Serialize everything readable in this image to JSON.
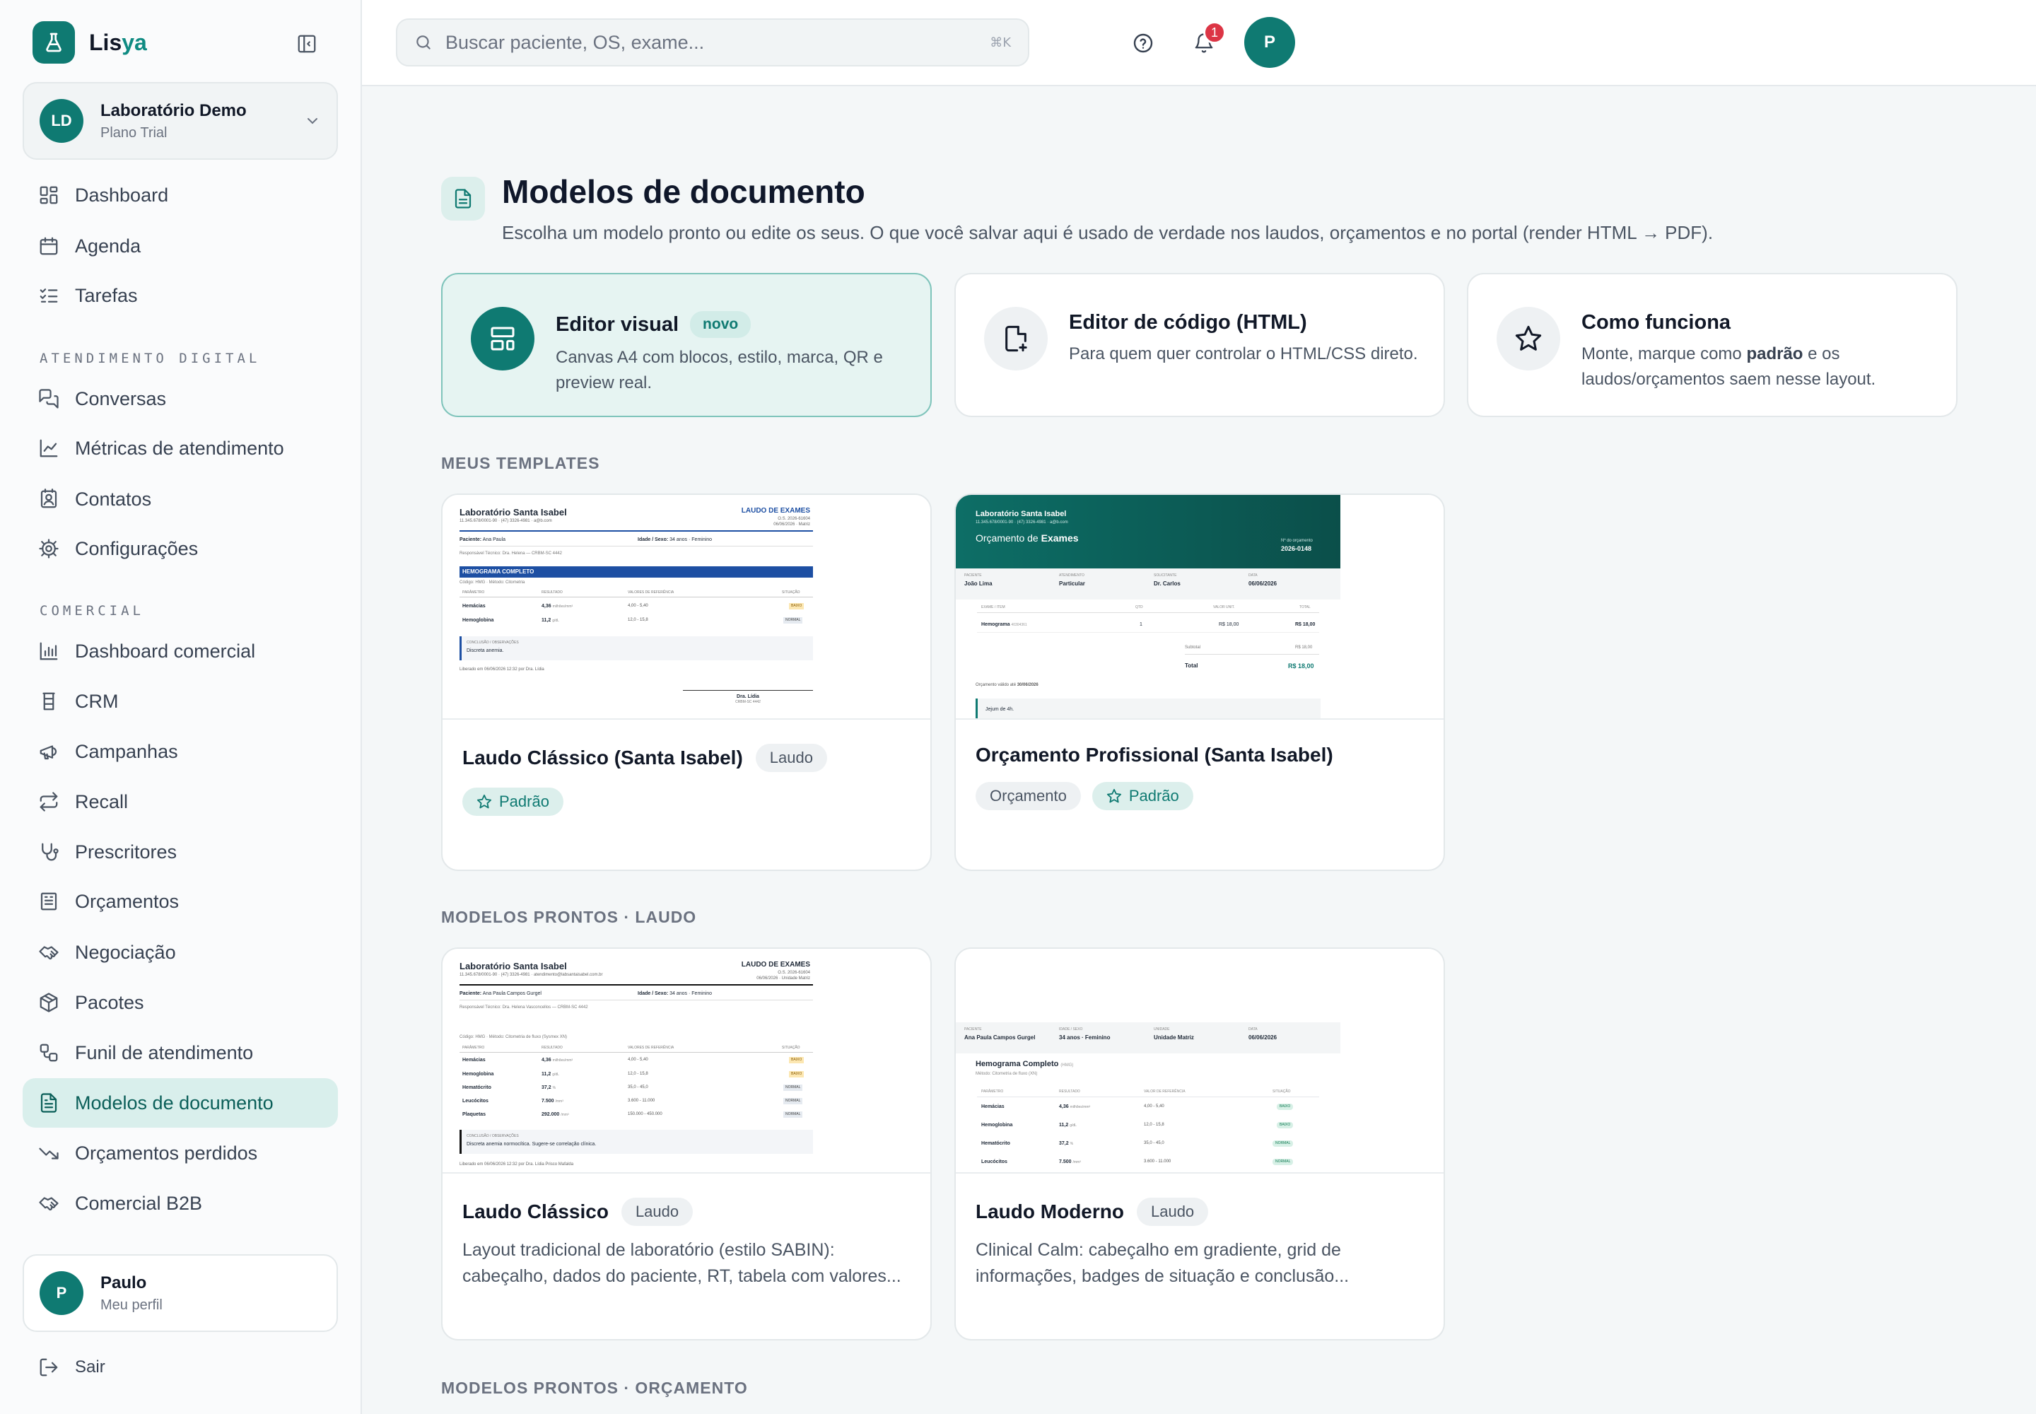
{
  "brand": {
    "name_prefix": "Lis",
    "name_accent": "ya"
  },
  "org": {
    "initials": "LD",
    "name": "Laboratório Demo",
    "plan": "Plano Trial"
  },
  "nav": {
    "main": [
      {
        "label": "Dashboard"
      },
      {
        "label": "Agenda"
      },
      {
        "label": "Tarefas"
      }
    ],
    "section_atendimento": "ATENDIMENTO DIGITAL",
    "atendimento": [
      {
        "label": "Conversas"
      },
      {
        "label": "Métricas de atendimento"
      },
      {
        "label": "Contatos"
      },
      {
        "label": "Configurações"
      }
    ],
    "section_comercial": "COMERCIAL",
    "comercial": [
      {
        "label": "Dashboard comercial"
      },
      {
        "label": "CRM"
      },
      {
        "label": "Campanhas"
      },
      {
        "label": "Recall"
      },
      {
        "label": "Prescritores"
      },
      {
        "label": "Orçamentos"
      },
      {
        "label": "Negociação"
      },
      {
        "label": "Pacotes"
      },
      {
        "label": "Funil de atendimento"
      },
      {
        "label": "Modelos de documento"
      },
      {
        "label": "Orçamentos perdidos"
      },
      {
        "label": "Comercial B2B"
      }
    ]
  },
  "user": {
    "initial": "P",
    "name": "Paulo",
    "subtitle": "Meu perfil"
  },
  "logout": "Sair",
  "search": {
    "placeholder": "Buscar paciente, OS, exame...",
    "shortcut": "⌘K"
  },
  "notifications": {
    "count": "1"
  },
  "page": {
    "title": "Modelos de documento",
    "subtitle": "Escolha um modelo pronto ou edite os seus. O que você salvar aqui é usado de verdade nos laudos, orçamentos e no portal (render HTML → PDF)."
  },
  "features": [
    {
      "title": "Editor visual",
      "badge": "novo",
      "desc": "Canvas A4 com blocos, estilo, marca, QR e preview real."
    },
    {
      "title": "Editor de código (HTML)",
      "desc": "Para quem quer controlar o HTML/CSS direto."
    },
    {
      "title": "Como funciona",
      "desc_pre": "Monte, marque como ",
      "desc_bold": "padrão",
      "desc_post": " e os laudos/orçamentos saem nesse layout."
    }
  ],
  "sections": {
    "mine": "MEUS TEMPLATES",
    "laudo": "MODELOS PRONTOS · LAUDO",
    "orcamento": "MODELOS PRONTOS · ORÇAMENTO"
  },
  "my_templates": [
    {
      "title": "Laudo Clássico (Santa Isabel)",
      "type": "Laudo",
      "default": "Padrão"
    },
    {
      "title": "Orçamento Profissional (Santa Isabel)",
      "type": "Orçamento",
      "default": "Padrão"
    }
  ],
  "laudo_templates": [
    {
      "title": "Laudo Clássico",
      "type": "Laudo",
      "desc": "Layout tradicional de laboratório (estilo SABIN): cabeçalho, dados do paciente, RT, tabela com valores..."
    },
    {
      "title": "Laudo Moderno",
      "type": "Laudo",
      "desc": "Clinical Calm: cabeçalho em gradiente, grid de informações, badges de situação e conclusão..."
    }
  ],
  "previews": {
    "lab": "Laboratório Santa Isabel",
    "lab_info": "11.345.678/0001-90 · (47) 3326-4981 · a@b.com",
    "doc": "LAUDO DE EXAMES",
    "os": "O.S. 2026-61604",
    "date": "06/06/2026 · Matriz",
    "patient_label": "Paciente:",
    "patient": "Ana Paula",
    "age_label": "Idade / Sexo:",
    "age": "34 anos · Feminino",
    "rt": "Responsável Técnico: Dra. Helena — CRBM-SC 4442",
    "exam": "HEMOGRAMA COMPLETO",
    "exam_sub": "Código: HMG · Método: Citometria",
    "cols": [
      "PARÂMETRO",
      "RESULTADO",
      "VALORES DE REFERÊNCIA",
      "SITUAÇÃO"
    ],
    "rows": [
      {
        "p": "Hemácias",
        "r": "4,36",
        "u": "milhões/mm³",
        "ref": "4,00 - 5,40",
        "s": "BAIXO"
      },
      {
        "p": "Hemoglobina",
        "r": "11,2",
        "u": "g/dL",
        "ref": "12,0 - 15,8",
        "s": "NORMAL"
      }
    ],
    "concl_label": "CONCLUSÃO / OBSERVAÇÕES",
    "concl": "Discreta anemia.",
    "released": "Liberado em 06/06/2026 12:32 por Dra. Lídia",
    "signer": "Dra. Lídia",
    "signer_reg": "CRBM-SC 4442",
    "orc_title_pre": "Orçamento de ",
    "orc_title_bold": "Exames",
    "orc_num_label": "Nº do orçamento",
    "orc_num": "2026-0148",
    "orc_fields": [
      {
        "k": "PACIENTE",
        "v": "João Lima"
      },
      {
        "k": "ATENDIMENTO",
        "v": "Particular"
      },
      {
        "k": "SOLICITANTE",
        "v": "Dr. Carlos"
      },
      {
        "k": "DATA",
        "v": "06/06/2026"
      }
    ],
    "orc_cols": [
      "EXAME / ITEM",
      "QTD",
      "VALOR UNIT.",
      "TOTAL"
    ],
    "orc_item": "Hemograma",
    "orc_code": "40304361",
    "orc_qty": "1",
    "orc_unit": "R$ 18,00",
    "orc_total": "R$ 18,00",
    "orc_subtotal_label": "Subtotal",
    "orc_subtotal": "R$ 18,00",
    "orc_grand_label": "Total",
    "orc_grand": "R$ 18,00",
    "orc_valid": "Orçamento válido até ",
    "orc_valid_date": "30/06/2026",
    "orc_note": "Jejum de 4h.",
    "c_lab_info": "11.345.678/0001-90 · (47) 3326-4981 · atendimento@labsantaisabel.com.br",
    "c_date": "06/06/2026 · Unidade Matriz",
    "c_patient": "Ana Paula Campos Gurgel",
    "c_rt": "Responsável Técnico: Dra. Helena Vasconcellos — CRBM-SC 4442",
    "c_exam_sub": "Código: HMG · Método: Citometria de fluxo (Sysmex XN)",
    "c_rows": [
      {
        "p": "Hemácias",
        "r": "4,36",
        "u": "milhões/mm³",
        "ref": "4,00 - 5,40",
        "s": "BAIXO"
      },
      {
        "p": "Hemoglobina",
        "r": "11,2",
        "u": "g/dL",
        "ref": "12,0 - 15,8",
        "s": "BAIXO"
      },
      {
        "p": "Hematócrito",
        "r": "37,2",
        "u": "%",
        "ref": "35,0 - 45,0",
        "s": "NORMAL"
      },
      {
        "p": "Leucócitos",
        "r": "7.500",
        "u": "/mm³",
        "ref": "3.600 - 11.000",
        "s": "NORMAL"
      },
      {
        "p": "Plaquetas",
        "r": "292.000",
        "u": "/mm³",
        "ref": "150.000 - 450.000",
        "s": "NORMAL"
      }
    ],
    "c_concl": "Discreta anemia normocítica. Sugere-se correlação clínica.",
    "c_released": "Liberado em 06/06/2026 12:32 por Dra. Lídia Prisco Mafalda",
    "m_fields": [
      {
        "k": "PACIENTE",
        "v": "Ana Paula Campos Gurgel"
      },
      {
        "k": "IDADE / SEXO",
        "v": "34 anos · Feminino"
      },
      {
        "k": "UNIDADE",
        "v": "Unidade Matriz"
      },
      {
        "k": "DATA",
        "v": "06/06/2026"
      }
    ],
    "m_exam": "Hemograma Completo",
    "m_exam_code": "(HMG)",
    "m_exam_sub": "Método: Citometria de fluxo (XN)",
    "m_cols": [
      "PARÂMETRO",
      "RESULTADO",
      "VALOR DE REFERÊNCIA",
      "SITUAÇÃO"
    ],
    "m_rows": [
      {
        "p": "Hemácias",
        "r": "4,36",
        "u": "milhões/mm³",
        "ref": "4,00 - 5,40",
        "s": "BAIXO"
      },
      {
        "p": "Hemoglobina",
        "r": "11,2",
        "u": "g/dL",
        "ref": "12,0 - 15,8",
        "s": "BAIXO"
      },
      {
        "p": "Hematócrito",
        "r": "37,2",
        "u": "%",
        "ref": "35,0 - 45,0",
        "s": "NORMAL"
      },
      {
        "p": "Leucócitos",
        "r": "7.500",
        "u": "/mm³",
        "ref": "3.600 - 11.000",
        "s": "NORMAL"
      }
    ]
  },
  "colors": {
    "primary": "#0f7a72",
    "accent_soft": "#d9efec",
    "alert": "#dc3545",
    "doc_blue": "#1d4fa3"
  }
}
